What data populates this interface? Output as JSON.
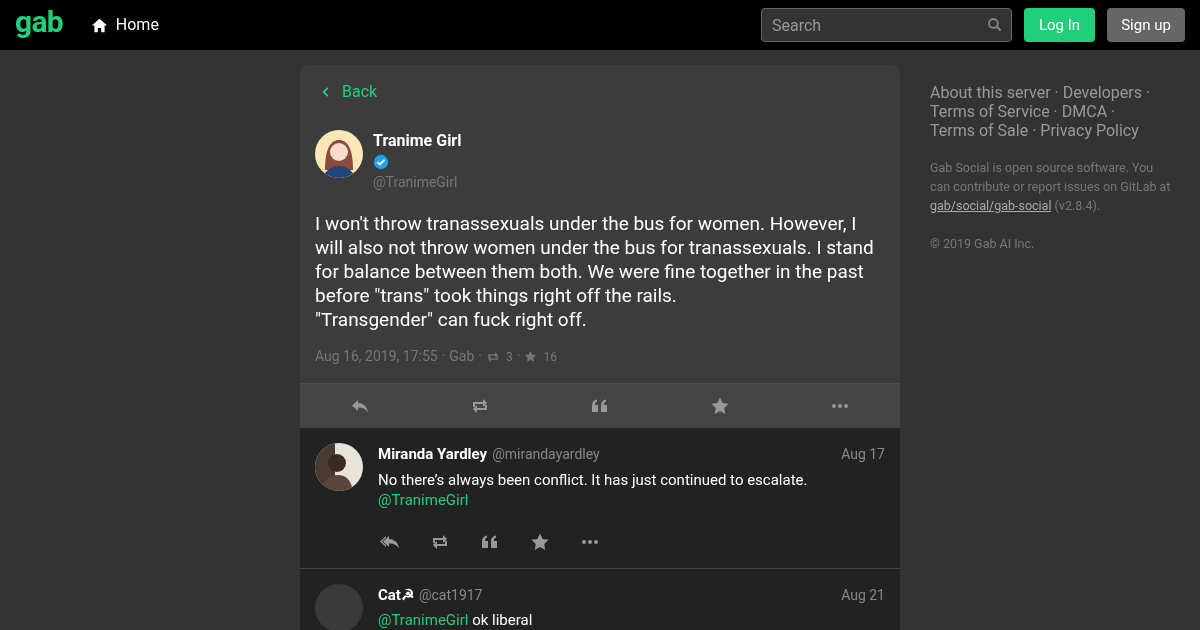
{
  "header": {
    "logo": "gab",
    "nav": [
      {
        "label": "Home"
      }
    ],
    "search": {
      "placeholder": "Search"
    },
    "buttons": [
      {
        "label": "Log In",
        "kind": "primary"
      },
      {
        "label": "Sign up",
        "kind": "secondary"
      }
    ]
  },
  "status": {
    "back": "Back",
    "author": {
      "name": "Tranime Girl",
      "verified": true,
      "handle": "@TranimeGirl"
    },
    "text": [
      "I won't throw tranassexuals under the bus for women. However, I will also not throw women under the bus for tranassexuals. I stand for balance between them both. We were fine together in the past before \"trans\" took things right off the rails.",
      "\"Transgender\" can fuck right off."
    ],
    "date": "Aug 16, 2019, 17:55",
    "separator": "·",
    "app": "Gab",
    "reposts": "3",
    "favourites": "16"
  },
  "replies": [
    {
      "name": "Miranda Yardley",
      "handle": "@mirandayardley",
      "date": "Aug 17",
      "body": [
        {
          "kind": "text",
          "text": "No there’s always been conflict. It has just continued to escalate."
        },
        {
          "kind": "break"
        },
        {
          "kind": "mention",
          "text": "@TranimeGirl"
        }
      ],
      "actions": true
    },
    {
      "name": "Cat☭",
      "handle": "@cat1917",
      "date": "Aug 21",
      "body": [
        {
          "kind": "mention",
          "text": "@TranimeGirl"
        },
        {
          "kind": "text",
          "text": " ok liberal"
        }
      ],
      "actions": false
    }
  ],
  "sidebar": {
    "separator": "·",
    "links": [
      "About this server",
      "Developers",
      "Terms of Service",
      "DMCA",
      "Terms of Sale",
      "Privacy Policy"
    ],
    "about": "Gab Social is open source software. You can contribute or report issues on GitLab at",
    "repo": "gab/social/gab-social",
    "version": " (v2.8.4).",
    "copyright": "© 2019 Gab AI Inc."
  }
}
